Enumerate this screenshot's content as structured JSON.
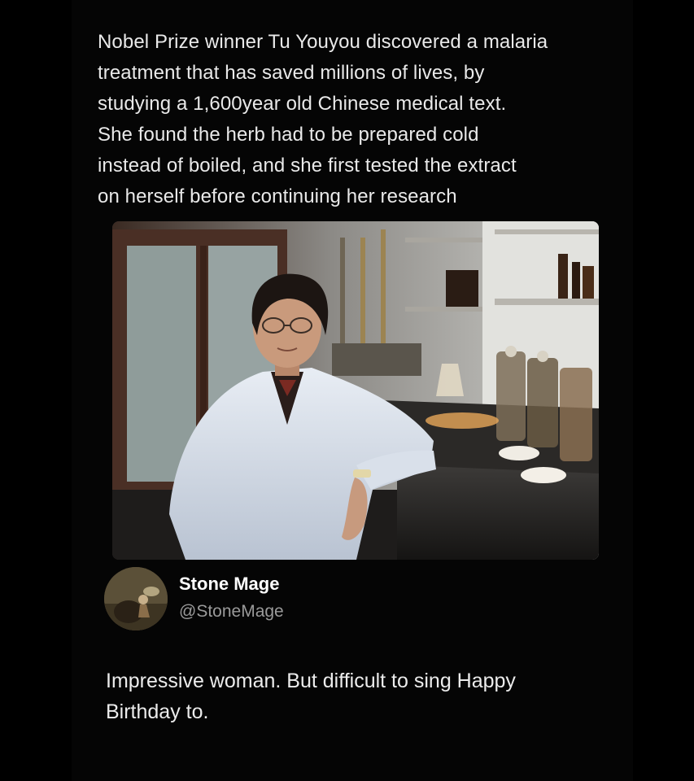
{
  "post": {
    "text": "Nobel Prize winner Tu Youyou discovered a malaria\ntreatment that has saved millions of lives, by\nstudying a 1,600year old Chinese medical text.\nShe found the herb had to be prepared cold\ninstead of boiled, and she first tested the extract\non herself before continuing her research"
  },
  "photo": {
    "icon": "lab-photo"
  },
  "author": {
    "name": "Stone Mage",
    "handle": "@StoneMage",
    "avatar_icon": "stone-mage-avatar-icon"
  },
  "reply": {
    "text": "Impressive woman. But difficult to sing Happy\nBirthday to."
  },
  "colors": {
    "background": "#000000",
    "text": "#e9e9e9",
    "handle": "#9a9a9a"
  }
}
